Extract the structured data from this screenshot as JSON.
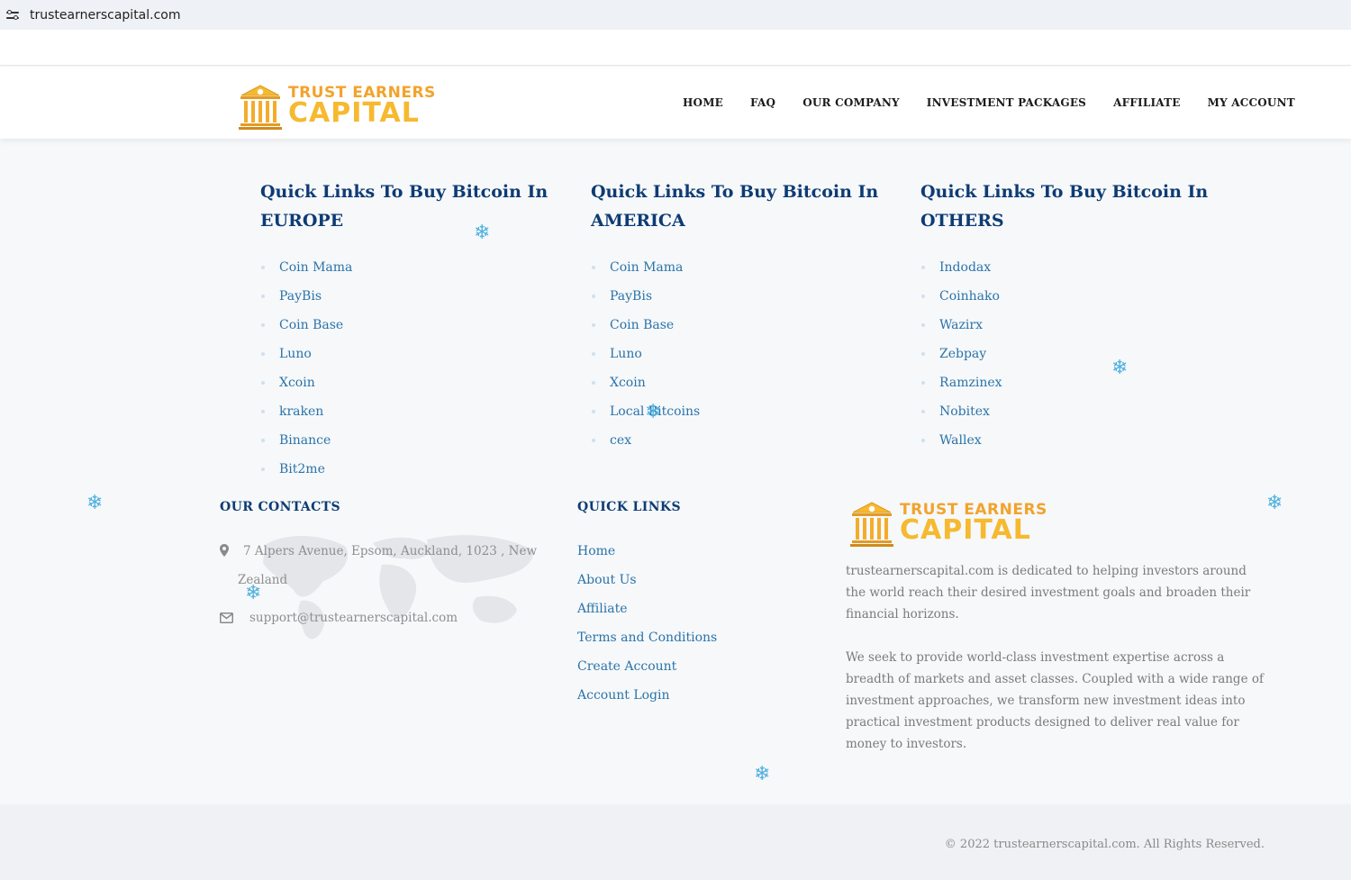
{
  "browser": {
    "url": "trustearnerscapital.com"
  },
  "brand": {
    "line1": "TRUST EARNERS",
    "line2": "CAPITAL"
  },
  "nav": [
    "HOME",
    "FAQ",
    "OUR COMPANY",
    "INVESTMENT PACKAGES",
    "AFFILIATE",
    "MY ACCOUNT"
  ],
  "columns": [
    {
      "title_line1": "Quick Links To Buy Bitcoin In",
      "title_line2": "EUROPE",
      "links": [
        "Coin Mama",
        "PayBis",
        "Coin Base",
        "Luno",
        "Xcoin",
        "kraken",
        "Binance",
        "Bit2me"
      ]
    },
    {
      "title_line1": "Quick Links To Buy Bitcoin In",
      "title_line2": "AMERICA",
      "links": [
        "Coin Mama",
        "PayBis",
        "Coin Base",
        "Luno",
        "Xcoin",
        "Local Bitcoins",
        "cex"
      ]
    },
    {
      "title_line1": "Quick Links To Buy Bitcoin In",
      "title_line2": "OTHERS",
      "links": [
        "Indodax",
        "Coinhako",
        "Wazirx",
        "Zebpay",
        "Ramzinex",
        "Nobitex",
        "Wallex"
      ]
    }
  ],
  "contacts": {
    "heading": "OUR CONTACTS",
    "address_line1": "7 Alpers Avenue, Epsom, Auckland, 1023 , New",
    "address_line2": "Zealand",
    "email": "support@trustearnerscapital.com"
  },
  "quick_links": {
    "heading": "QUICK LINKS",
    "items": [
      "Home",
      "About Us",
      "Affiliate",
      "Terms and Conditions",
      "Create Account",
      "Account Login"
    ]
  },
  "about": {
    "para1": "trustearnerscapital.com is dedicated to helping investors around the world reach their desired investment goals and broaden their financial horizons.",
    "para2": "We seek to provide world-class investment expertise across a breadth of markets and asset classes. Coupled with a wide range of investment approaches, we transform new investment ideas into practical investment products designed to deliver real value for money to investors."
  },
  "copyright": "© 2022 trustearnerscapital.com. All Rights Reserved.",
  "icons": [
    "tune-icon",
    "bank-logo-icon",
    "location-pin-icon",
    "envelope-icon",
    "snowflake-icon",
    "world-map-icon"
  ],
  "colors": {
    "heading": "#0e3b73",
    "link": "#2b73a8",
    "gold": "#f6b92f",
    "snowflake": "#4fb0de"
  }
}
